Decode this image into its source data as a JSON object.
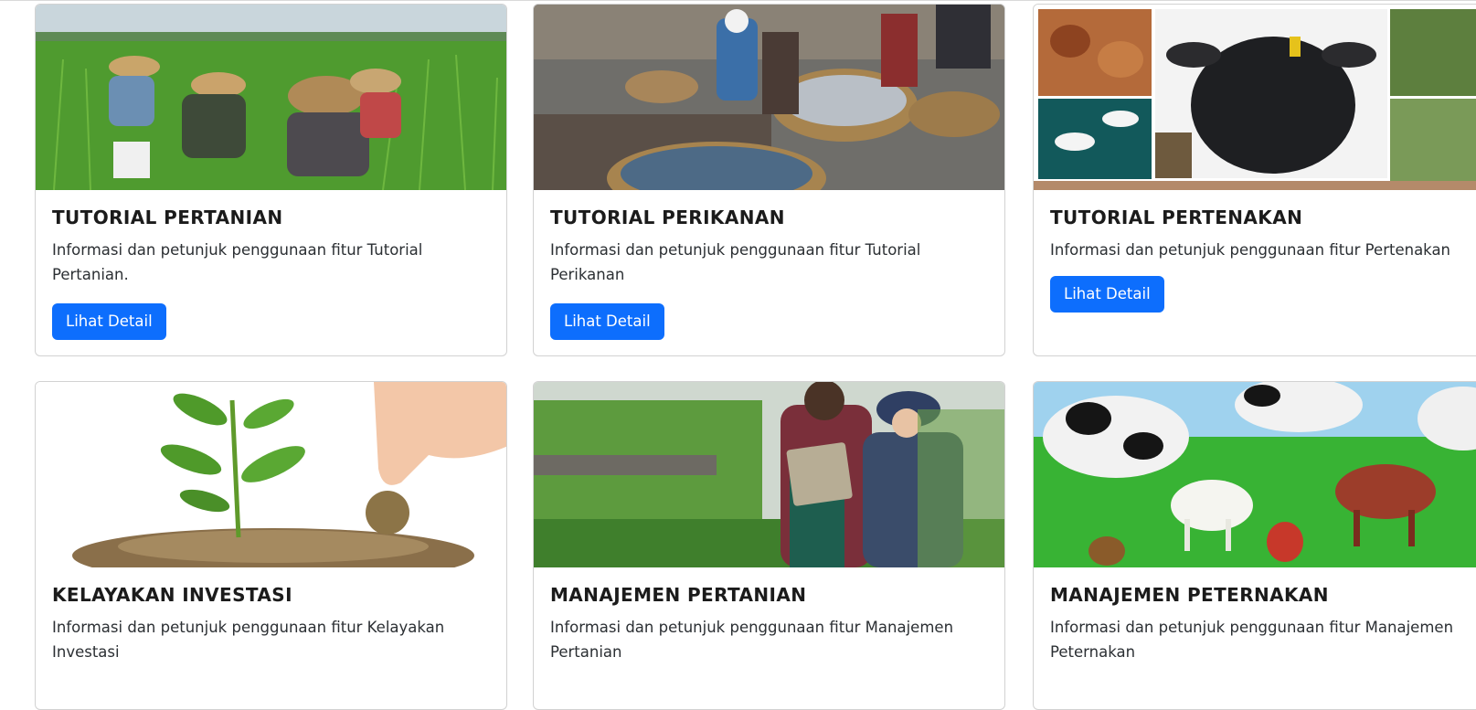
{
  "cards": [
    {
      "title": "TUTORIAL PERTANIAN",
      "description": "Informasi dan petunjuk penggunaan fitur Tutorial Pertanian.",
      "button_label": "Lihat Detail",
      "image": "rice-field-farmers-photo"
    },
    {
      "title": "TUTORIAL PERIKANAN",
      "description": "Informasi dan petunjuk penggunaan fitur Tutorial Perikanan",
      "button_label": "Lihat Detail",
      "image": "fish-market-photo"
    },
    {
      "title": "TUTORIAL PERTENAKAN",
      "description": "Informasi dan petunjuk penggunaan fitur Pertenakan",
      "button_label": "Lihat Detail",
      "image": "livestock-collage-photo"
    },
    {
      "title": "KELAYAKAN INVESTASI",
      "description": "Informasi dan petunjuk penggunaan fitur Kelayakan Investasi",
      "image": "plant-coins-photo"
    },
    {
      "title": "MANAJEMEN PERTANIAN",
      "description": "Informasi dan petunjuk penggunaan fitur Manajemen Pertanian",
      "image": "greenhouse-tablet-photo"
    },
    {
      "title": "MANAJEMEN PETERNAKAN",
      "description": "Informasi dan petunjuk penggunaan fitur Manajemen Peternakan",
      "image": "farm-animals-photo"
    }
  ],
  "colors": {
    "button": "#0d6efd",
    "button_text": "#ffffff",
    "card_border": "#dcdcdc"
  }
}
